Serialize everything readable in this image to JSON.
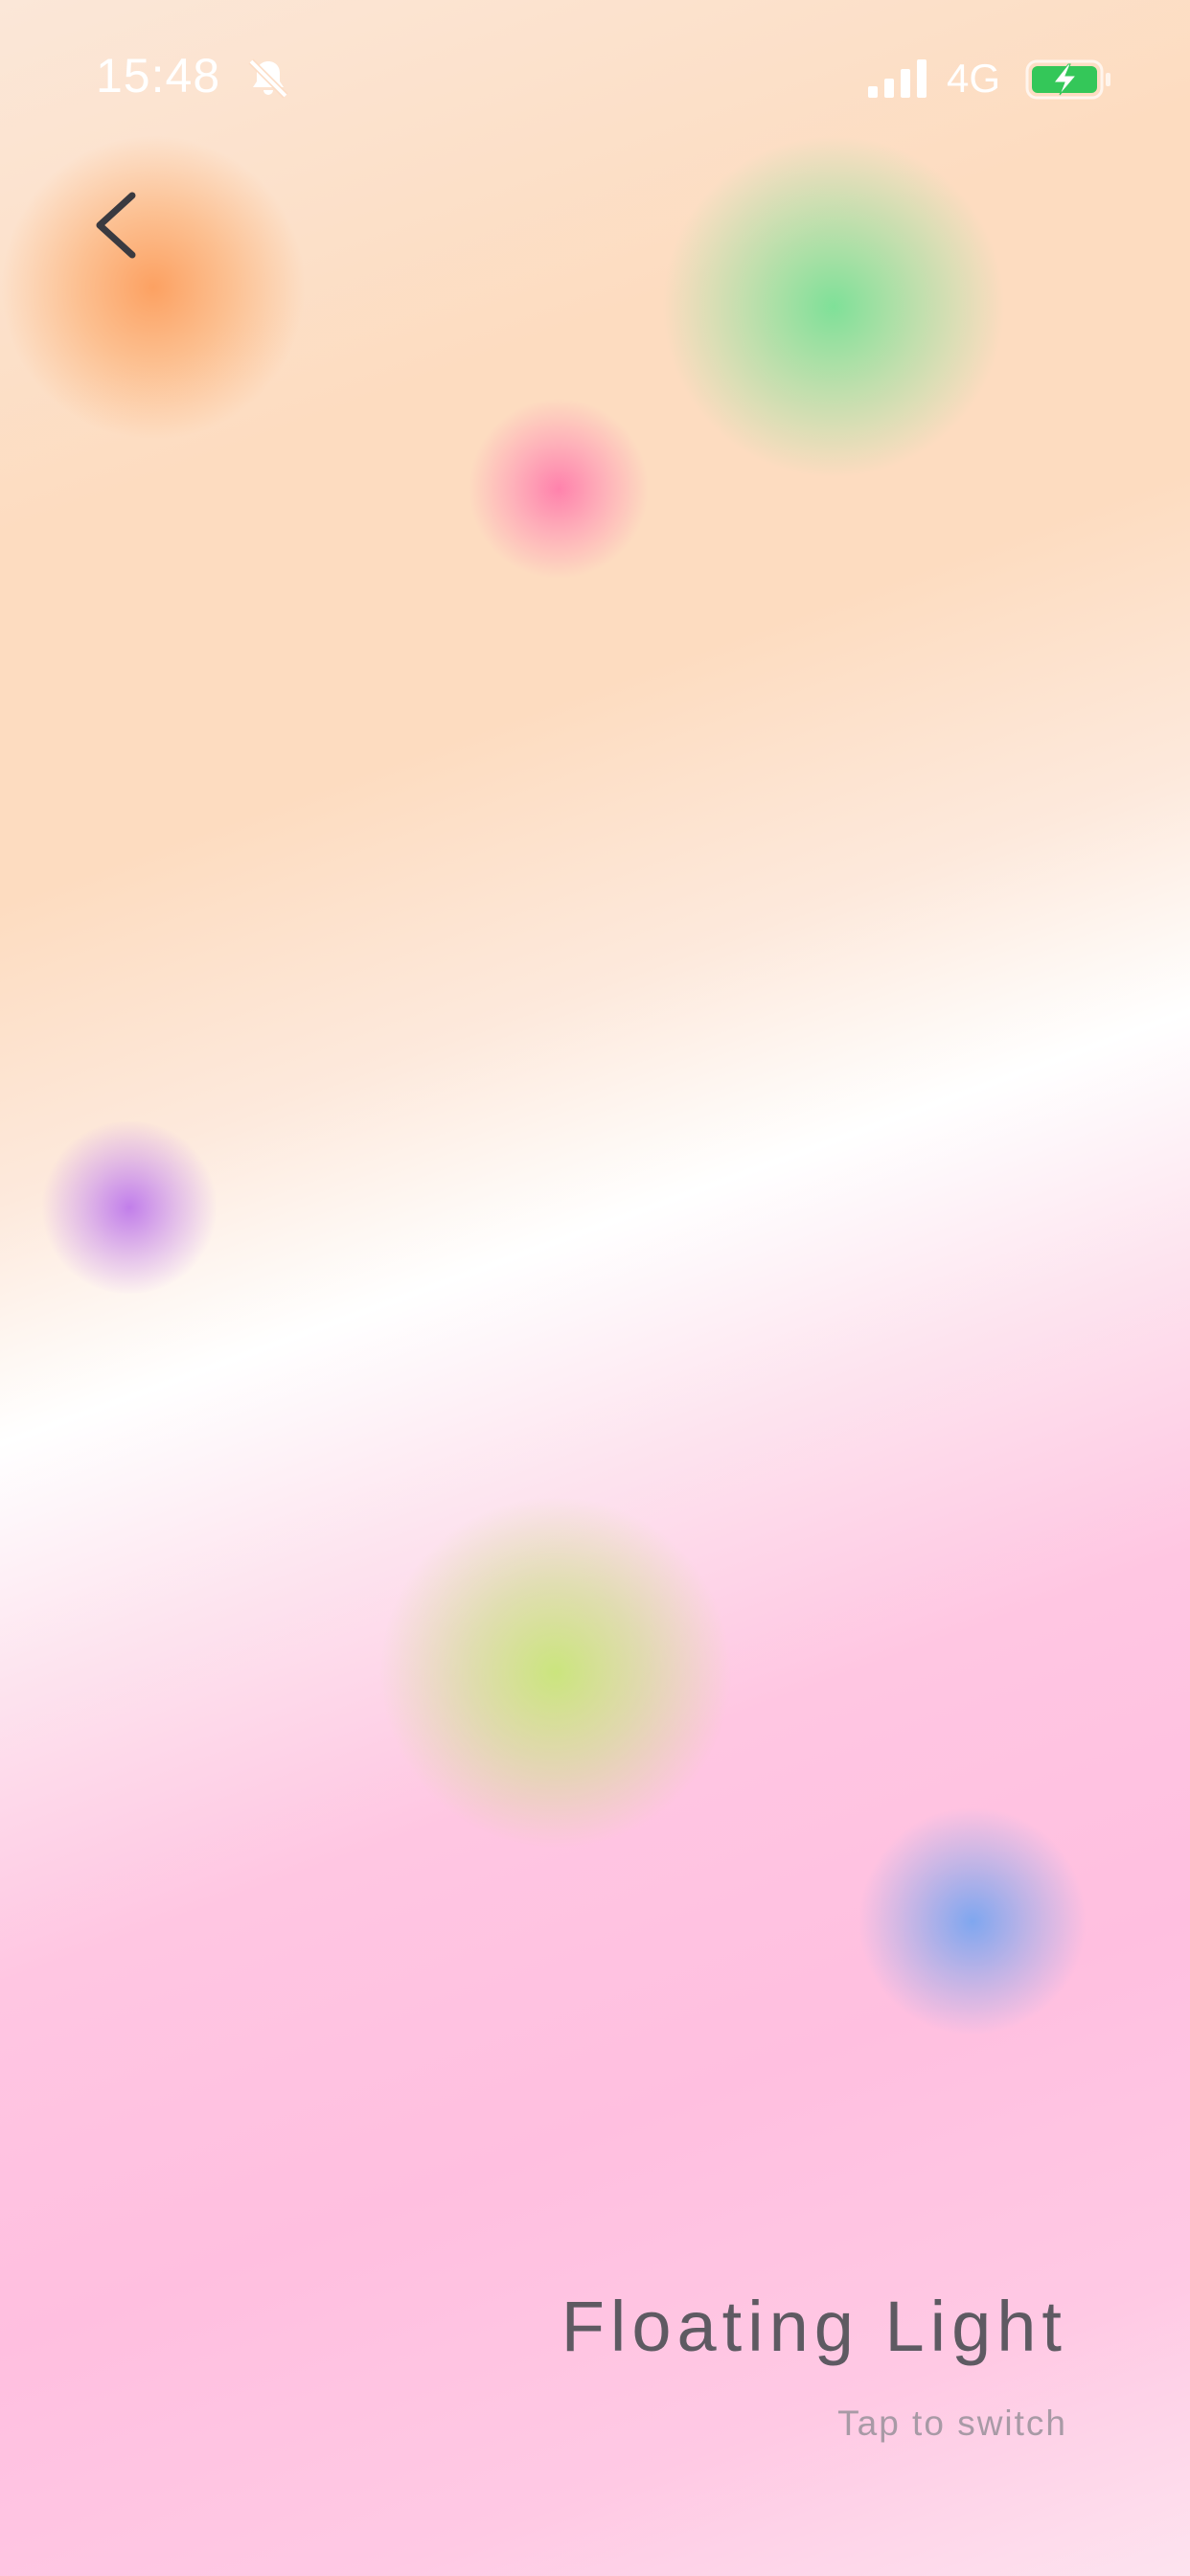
{
  "status_bar": {
    "time": "15:48",
    "network": "4G",
    "icons": [
      "bell-slash-icon",
      "cellular-signal-icon",
      "battery-charging-icon"
    ]
  },
  "navigation": {
    "back_icon": "chevron-left-icon"
  },
  "light_orbs": [
    {
      "color": "orange"
    },
    {
      "color": "green"
    },
    {
      "color": "pink"
    },
    {
      "color": "purple"
    },
    {
      "color": "lime"
    },
    {
      "color": "blue"
    }
  ],
  "scene": {
    "title": "Floating Light",
    "hint": "Tap to switch"
  },
  "colors": {
    "title_text": "#5e5a62",
    "hint_text": "#a89aa6",
    "battery_fill": "#34c759",
    "back_chevron": "#3a3a40"
  }
}
